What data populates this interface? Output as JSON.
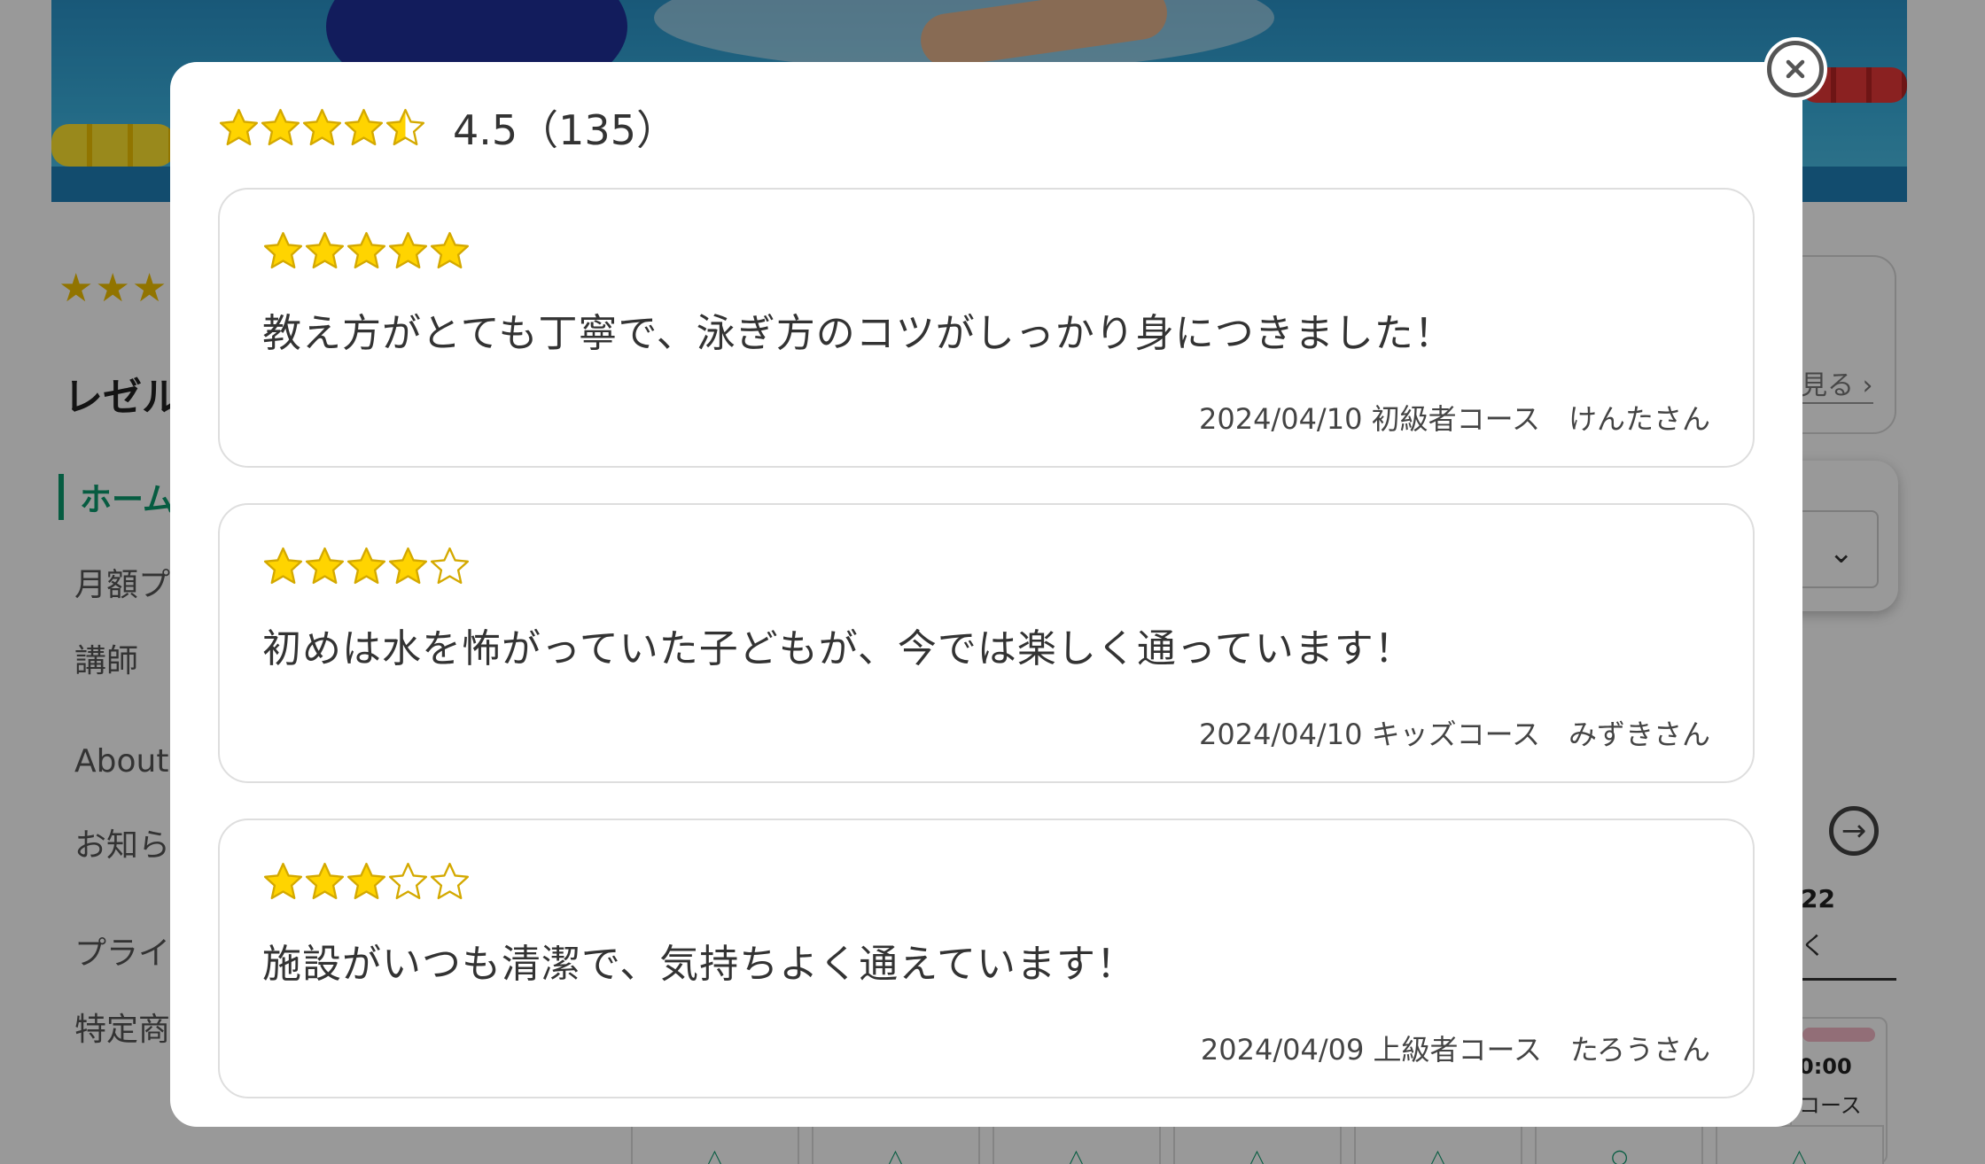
{
  "background": {
    "school_name": "レゼル",
    "rating_stars": "★★★",
    "nav_items": [
      {
        "label": "ホーム",
        "active": true
      },
      {
        "label": "月額プ",
        "active": false
      },
      {
        "label": "講師",
        "active": false
      },
      {
        "label": "About",
        "active": false
      },
      {
        "label": "お知ら",
        "active": false
      },
      {
        "label": "プライ",
        "active": false
      },
      {
        "label": "特定商",
        "active": false
      }
    ],
    "more_link": "見る ›",
    "date_label": "22",
    "date_sub": "く",
    "slot_time": "0:00",
    "slot_course": "コース"
  },
  "modal": {
    "close_icon": "close-circle-icon",
    "summary": {
      "rating": 4.5,
      "score_text": "4.5（135）"
    },
    "reviews": [
      {
        "rating": 5,
        "text": "教え方がとても丁寧で、泳ぎ方のコツがしっかり身につきました！",
        "meta": "2024/04/10 初級者コース　けんたさん"
      },
      {
        "rating": 4,
        "text": "初めは水を怖がっていた子どもが、今では楽しく通っています！",
        "meta": "2024/04/10 キッズコース　みずきさん"
      },
      {
        "rating": 3,
        "text": "施設がいつも清潔で、気持ちよく通えています！",
        "meta": "2024/04/09 上級者コース　たろうさん"
      }
    ]
  },
  "colors": {
    "star_fill": "#ffd400",
    "star_stroke": "#d4a900",
    "accent_green": "#0b9a6d",
    "overlay": "rgba(0,0,0,0.40)"
  }
}
